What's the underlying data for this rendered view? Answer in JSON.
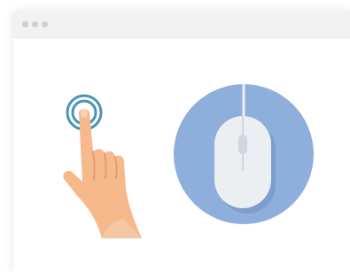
{
  "window": {
    "controls": [
      "window-dot",
      "window-dot",
      "window-dot"
    ]
  },
  "illustration": {
    "left_icon": "hand-tap-icon",
    "right_icon": "computer-mouse-icon"
  },
  "colors": {
    "titlebar": "#f2f2f2",
    "window_dots": "#cfcfcf",
    "tap_rings": "#4a94b8",
    "skin": "#f6b98c",
    "skin_shadow": "#e39d72",
    "sleeve": "#f4c6a4",
    "mouse_circle": "#8eaedb",
    "mouse_body": "#eceff2",
    "mouse_shadow": "#b7c2cc"
  }
}
